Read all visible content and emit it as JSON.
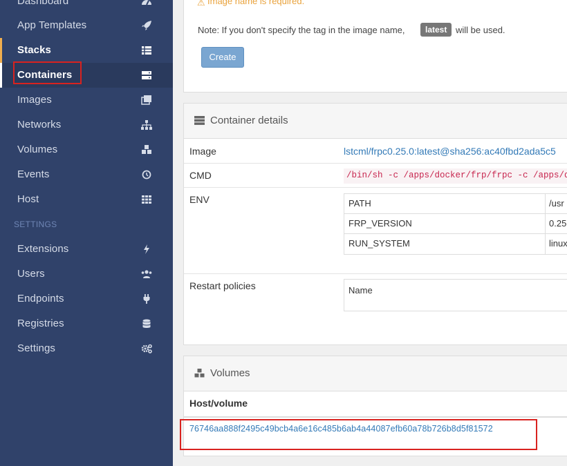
{
  "sidebar": {
    "items": [
      {
        "label": "Dashboard",
        "icon": "tachometer-icon"
      },
      {
        "label": "App Templates",
        "icon": "rocket-icon"
      },
      {
        "label": "Stacks",
        "icon": "list-icon"
      },
      {
        "label": "Containers",
        "icon": "server-icon"
      },
      {
        "label": "Images",
        "icon": "clone-icon"
      },
      {
        "label": "Networks",
        "icon": "sitemap-icon"
      },
      {
        "label": "Volumes",
        "icon": "cubes-icon"
      },
      {
        "label": "Events",
        "icon": "history-icon"
      },
      {
        "label": "Host",
        "icon": "th-icon"
      }
    ],
    "settings_title": "SETTINGS",
    "settings_items": [
      {
        "label": "Extensions",
        "icon": "bolt-icon"
      },
      {
        "label": "Users",
        "icon": "users-icon"
      },
      {
        "label": "Endpoints",
        "icon": "plug-icon"
      },
      {
        "label": "Registries",
        "icon": "database-icon"
      },
      {
        "label": "Settings",
        "icon": "cogs-icon"
      }
    ]
  },
  "image_form": {
    "warning": "Image name is required.",
    "note_prefix": "Note: If you don't specify the tag in the image name,",
    "tag_badge": "latest",
    "note_suffix": "will be used.",
    "create_button": "Create"
  },
  "container_details": {
    "title": "Container details",
    "image_label": "Image",
    "image_value": "lstcml/frpc0.25.0:latest@sha256:ac40fbd2ada5c5",
    "cmd_label": "CMD",
    "cmd_value": "/bin/sh -c /apps/docker/frp/frpc -c /apps/doc",
    "env_label": "ENV",
    "env": [
      {
        "key": "PATH",
        "value": "/usr"
      },
      {
        "key": "FRP_VERSION",
        "value": "0.25"
      },
      {
        "key": "RUN_SYSTEM",
        "value": "linux"
      }
    ],
    "restart_label": "Restart policies",
    "restart_name_header": "Name"
  },
  "volumes": {
    "title": "Volumes",
    "column_header": "Host/volume",
    "host_volume": "76746aa888f2495c49bcb4a6e16c485b6ab4a44087efb60a78b726b8d5f81572"
  },
  "colors": {
    "sidebar_bg": "#30426a",
    "highlight": "#d9221f",
    "link": "#337ab7",
    "warning": "#e9a23b"
  }
}
